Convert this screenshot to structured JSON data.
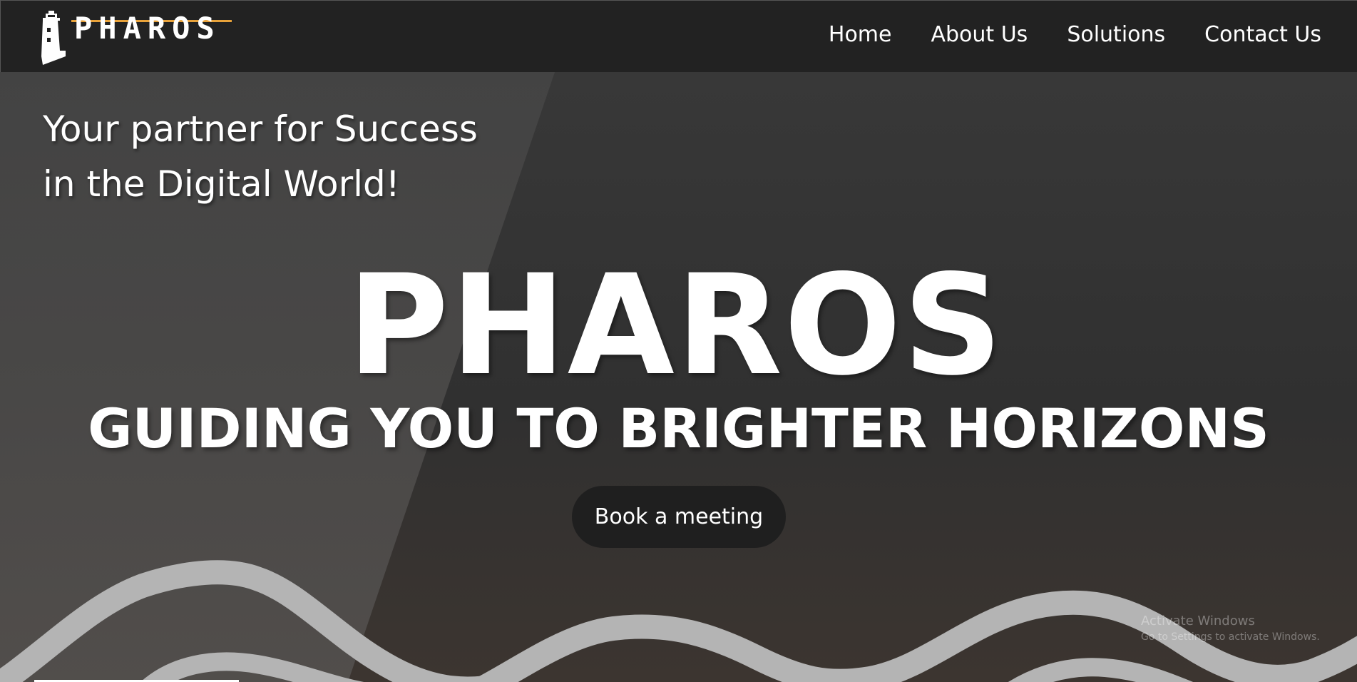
{
  "brand": {
    "logo_text": "PHAROS",
    "accent_color": "#e8a23a",
    "logo_icon": "lighthouse-icon"
  },
  "nav": {
    "items": [
      {
        "label": "Home"
      },
      {
        "label": "About Us"
      },
      {
        "label": "Solutions"
      },
      {
        "label": "Contact Us"
      }
    ]
  },
  "hero": {
    "tagline_line1": "Your partner for Success",
    "tagline_line2": "in the Digital World!",
    "title": "PHAROS",
    "subtitle": "GUIDING YOU TO BRIGHTER HORIZONS",
    "cta_label": "Book a meeting"
  },
  "watermark": {
    "title": "Activate Windows",
    "subtitle": "Go to Settings to activate Windows."
  }
}
